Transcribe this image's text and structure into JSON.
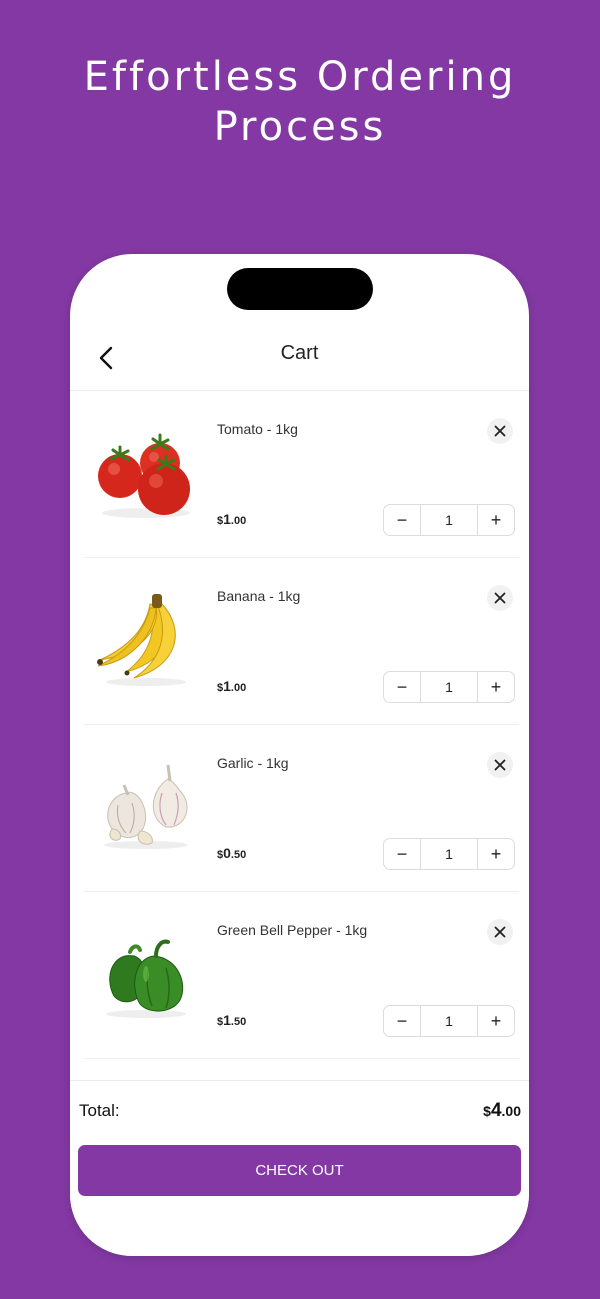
{
  "headline": {
    "line1": "Effortless Ordering",
    "line2": "Process"
  },
  "screen": {
    "title": "Cart",
    "back_icon": "chevron-left-icon"
  },
  "cart": {
    "items": [
      {
        "name": "Tomato - 1kg",
        "currency": "$",
        "price_main": "1",
        "price_cents": ".00",
        "qty": "1",
        "image": "tomato"
      },
      {
        "name": "Banana - 1kg",
        "currency": "$",
        "price_main": "1",
        "price_cents": ".00",
        "qty": "1",
        "image": "banana"
      },
      {
        "name": "Garlic - 1kg",
        "currency": "$",
        "price_main": "0",
        "price_cents": ".50",
        "qty": "1",
        "image": "garlic"
      },
      {
        "name": "Green Bell Pepper - 1kg",
        "currency": "$",
        "price_main": "1",
        "price_cents": ".50",
        "qty": "1",
        "image": "green-bell-pepper"
      }
    ],
    "minus_label": "−",
    "plus_label": "+"
  },
  "summary": {
    "total_label": "Total:",
    "total_currency": "$",
    "total_main": "4",
    "total_cents": ".00",
    "checkout_label": "CHECK OUT"
  },
  "colors": {
    "brand": "#8338a3",
    "background": "#ffffff"
  }
}
